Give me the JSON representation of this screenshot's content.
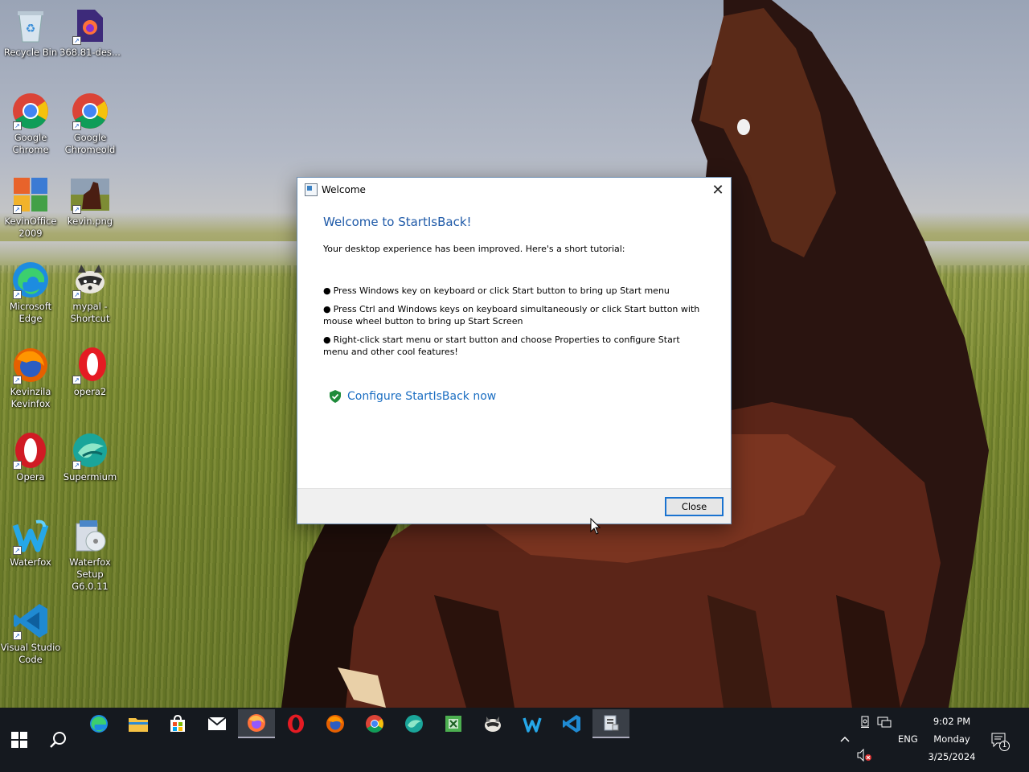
{
  "desktop": {
    "icons": [
      {
        "label": "Recycle Bin",
        "icon": "recycle-bin-icon"
      },
      {
        "label": "368.81-des...",
        "icon": "firefox-file-icon"
      },
      {
        "label": "Google Chrome",
        "icon": "chrome-icon"
      },
      {
        "label": "Google Chromeold",
        "icon": "chrome-icon"
      },
      {
        "label": "KevinOffice 2009",
        "icon": "office-icon"
      },
      {
        "label": "kevin.png",
        "icon": "image-file-icon"
      },
      {
        "label": "Microsoft Edge",
        "icon": "edge-icon"
      },
      {
        "label": "mypal - Shortcut",
        "icon": "mypal-icon"
      },
      {
        "label": "Kevinzila Kevinfox",
        "icon": "firefox-icon"
      },
      {
        "label": "opera2",
        "icon": "opera-icon"
      },
      {
        "label": "Opera",
        "icon": "opera-icon"
      },
      {
        "label": "Supermium",
        "icon": "supermium-icon"
      },
      {
        "label": "Waterfox",
        "icon": "waterfox-icon"
      },
      {
        "label": "Waterfox Setup G6.0.11",
        "icon": "installer-icon"
      },
      {
        "label": "Visual Studio Code",
        "icon": "vscode-icon"
      }
    ]
  },
  "dialog": {
    "title": "Welcome",
    "heading": "Welcome to StartIsBack!",
    "intro": "Your desktop experience has been improved. Here's a short tutorial:",
    "bullet": "●",
    "tips": [
      "Press Windows key on keyboard or click Start button to bring up Start menu",
      "Press Ctrl and Windows keys on keyboard simultaneously or click Start button with mouse wheel button to bring up Start Screen",
      "Right-click start menu or start button and choose Properties to configure Start menu and other cool features!"
    ],
    "link": "Configure StartIsBack now",
    "close_button": "Close"
  },
  "taskbar": {
    "apps": [
      {
        "name": "edge"
      },
      {
        "name": "file-explorer"
      },
      {
        "name": "store"
      },
      {
        "name": "mail"
      },
      {
        "name": "firefox-dev",
        "active": true
      },
      {
        "name": "opera"
      },
      {
        "name": "firefox"
      },
      {
        "name": "chrome"
      },
      {
        "name": "supermium"
      },
      {
        "name": "excel"
      },
      {
        "name": "mypal"
      },
      {
        "name": "waterfox"
      },
      {
        "name": "vscode"
      },
      {
        "name": "dialog-app",
        "active": true
      }
    ],
    "tray": {
      "language": "ENG",
      "time": "9:02 PM",
      "day": "Monday",
      "date": "3/25/2024",
      "notification_count": "1"
    }
  },
  "colors": {
    "taskbar": "#15191f",
    "dialog_heading": "#1f5aa8",
    "link": "#1b6ec2",
    "button_border": "#1a73d0"
  }
}
